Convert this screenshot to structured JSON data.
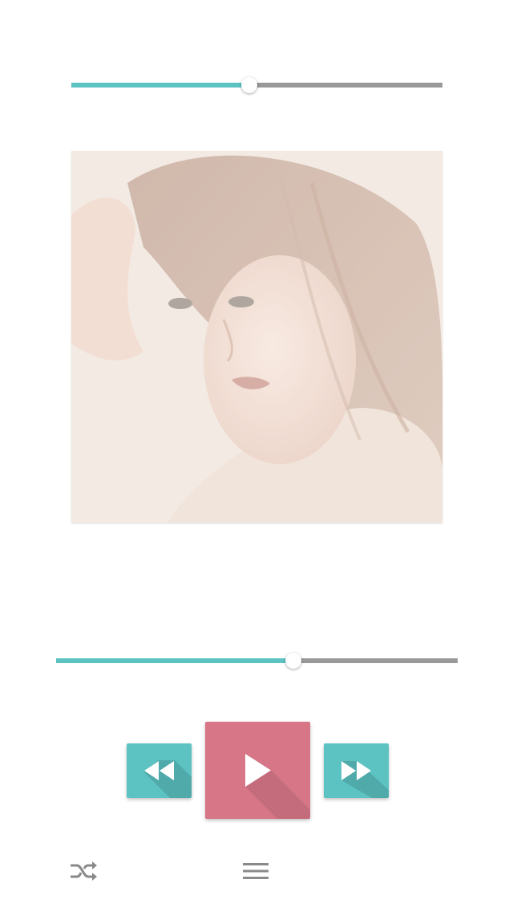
{
  "player": {
    "volume_level": 0.48,
    "playback_progress": 0.59
  },
  "icons": {
    "rewind": "rewind-icon",
    "play": "play-icon",
    "forward": "fast-forward-icon",
    "shuffle": "shuffle-icon",
    "playlist": "menu-icon"
  },
  "colors": {
    "accent_teal": "#5cc2c2",
    "play_pink": "#d67687",
    "track_gray": "#999999"
  }
}
